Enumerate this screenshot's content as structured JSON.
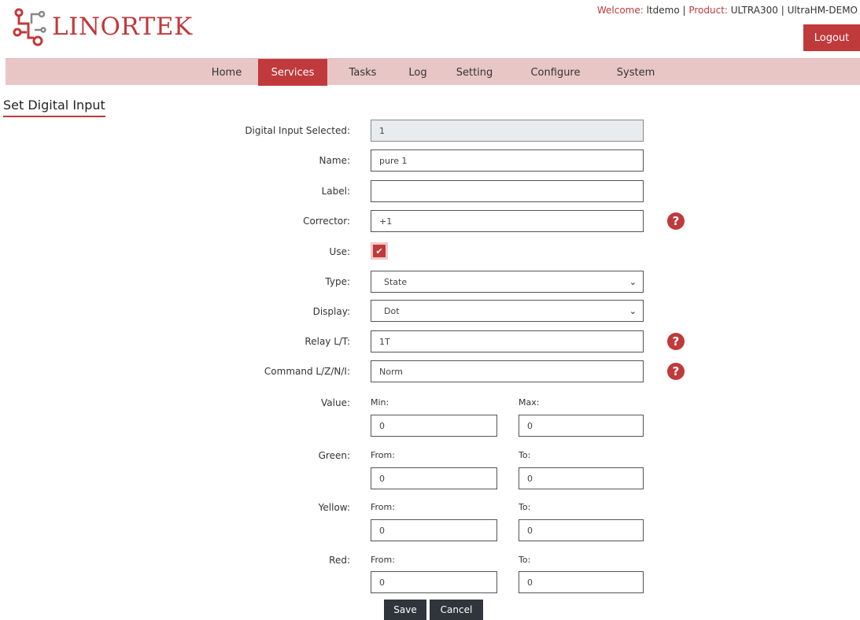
{
  "header": {
    "logo_text": "LINORTEK",
    "welcome_label": "Welcome: ",
    "user": "ltdemo",
    "sep1": " | ",
    "product_label": "Product: ",
    "product": "ULTRA300",
    "sep2": " | ",
    "device": "UltraHM-DEMO",
    "logout": "Logout",
    "accent_color": "#c0393b"
  },
  "nav": {
    "items": [
      "Home",
      "Services",
      "Tasks",
      "Log",
      "Setting",
      "Configure",
      "System"
    ],
    "active": "Services"
  },
  "page_title": "Set Digital Input",
  "form": {
    "digital_input_selected": {
      "label": "Digital Input Selected:",
      "value": "1"
    },
    "name": {
      "label": "Name:",
      "value": "pure 1"
    },
    "label": {
      "label": "Label:",
      "value": ""
    },
    "corrector": {
      "label": "Corrector:",
      "value": "+1"
    },
    "use": {
      "label": "Use:",
      "checked": true
    },
    "type": {
      "label": "Type:",
      "value": "State"
    },
    "display": {
      "label": "Display:",
      "value": "Dot"
    },
    "relay": {
      "label": "Relay L/T:",
      "value": "1T"
    },
    "command": {
      "label": "Command L/Z/N/I:",
      "value": "Norm"
    },
    "value_range": {
      "label": "Value:",
      "min_label": "Min:",
      "max_label": "Max:",
      "min": "0",
      "max": "0"
    },
    "green": {
      "label": "Green:",
      "from_label": "From:",
      "to_label": "To:",
      "from": "0",
      "to": "0"
    },
    "yellow": {
      "label": "Yellow:",
      "from_label": "From:",
      "to_label": "To:",
      "from": "0",
      "to": "0"
    },
    "red": {
      "label": "Red:",
      "from_label": "From:",
      "to_label": "To:",
      "from": "0",
      "to": "0"
    }
  },
  "buttons": {
    "save": "Save",
    "cancel": "Cancel"
  },
  "help_icon_glyph": "?",
  "icons": [
    "linortek-logo-icon",
    "help-icon",
    "check-icon",
    "chevron-down-icon"
  ]
}
